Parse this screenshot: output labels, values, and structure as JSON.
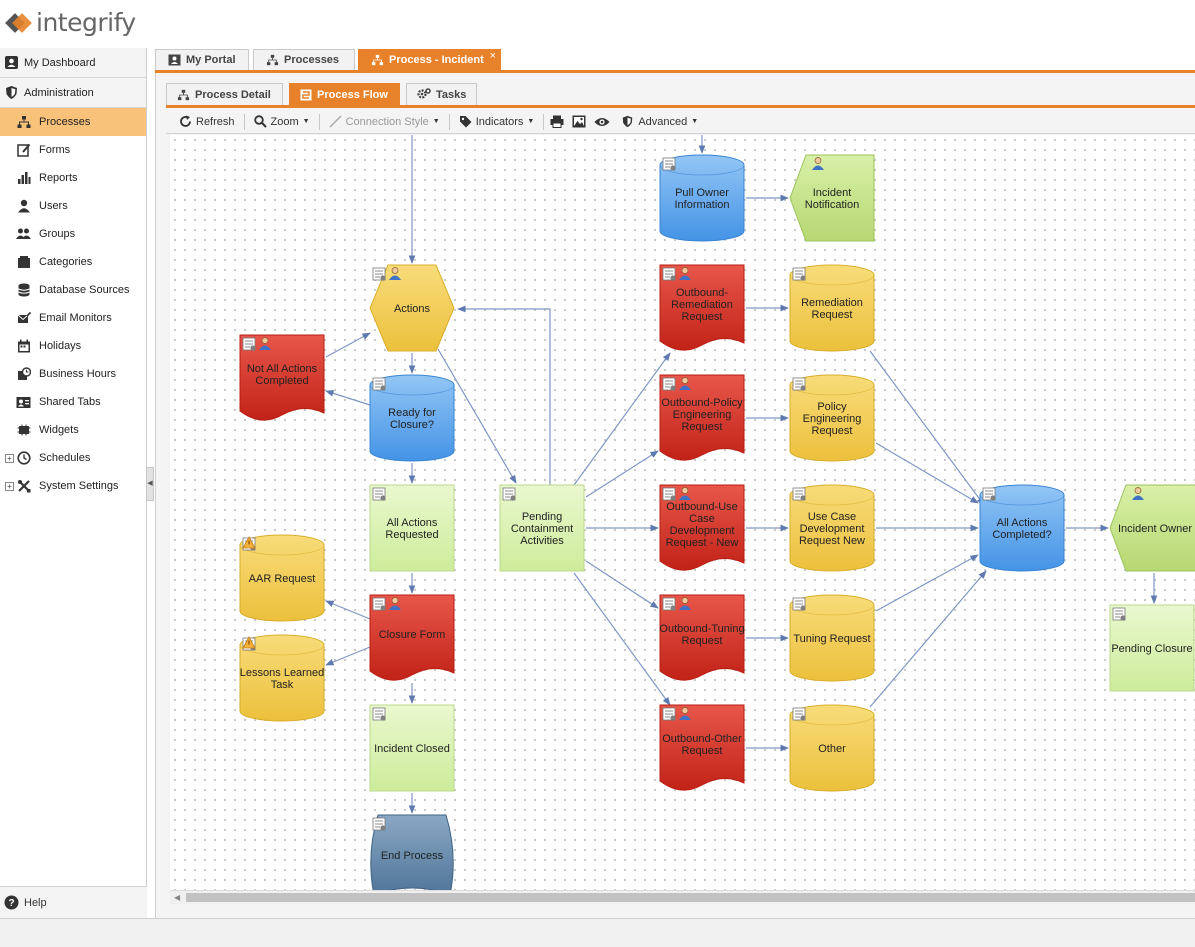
{
  "app": {
    "logo_text": "integrify"
  },
  "sidebar": {
    "dashboard_label": "My Dashboard",
    "admin_label": "Administration",
    "items": [
      {
        "label": "Processes",
        "icon": "sitemap-icon"
      },
      {
        "label": "Forms",
        "icon": "form-edit-icon"
      },
      {
        "label": "Reports",
        "icon": "bar-chart-icon"
      },
      {
        "label": "Users",
        "icon": "user-icon"
      },
      {
        "label": "Groups",
        "icon": "group-icon"
      },
      {
        "label": "Categories",
        "icon": "folder-icon"
      },
      {
        "label": "Database Sources",
        "icon": "database-icon"
      },
      {
        "label": "Email Monitors",
        "icon": "email-icon"
      },
      {
        "label": "Holidays",
        "icon": "calendar-icon"
      },
      {
        "label": "Business Hours",
        "icon": "clock-icon"
      },
      {
        "label": "Shared Tabs",
        "icon": "shared-tabs-icon"
      },
      {
        "label": "Widgets",
        "icon": "widget-icon"
      },
      {
        "label": "Schedules",
        "icon": "schedule-icon"
      },
      {
        "label": "System Settings",
        "icon": "tools-icon"
      }
    ],
    "help_label": "Help"
  },
  "tabs": {
    "my_portal": "My Portal",
    "processes": "Processes",
    "process_incident": "Process - Incident",
    "close_glyph": "×"
  },
  "subtabs": {
    "process_detail": "Process Detail",
    "process_flow": "Process Flow",
    "tasks": "Tasks"
  },
  "toolbar": {
    "refresh": "Refresh",
    "zoom": "Zoom",
    "connection_style": "Connection Style",
    "indicators": "Indicators",
    "advanced": "Advanced"
  },
  "colors": {
    "accent": "#e8822a",
    "active_sidebar": "#f9c27b",
    "red_task": "#d9362b",
    "yellow_task": "#f2c94c",
    "blue_task": "#5aa3ec",
    "green_task": "#d4f0a8",
    "dark_task": "#5f84a6"
  },
  "flow": {
    "nodes": [
      {
        "id": "pull_owner",
        "label": "Pull Owner Information",
        "shape": "cylinder",
        "color": "blue"
      },
      {
        "id": "incident_notification",
        "label": "Incident Notification",
        "shape": "pentagon",
        "color": "green"
      },
      {
        "id": "actions",
        "label": "Actions",
        "shape": "hexagon",
        "color": "yellow"
      },
      {
        "id": "not_all_actions",
        "label": "Not All Actions Completed",
        "shape": "document",
        "color": "red"
      },
      {
        "id": "ready_for_closure",
        "label": "Ready for Closure?",
        "shape": "cylinder",
        "color": "blue"
      },
      {
        "id": "all_actions_requested",
        "label": "All Actions Requested",
        "shape": "rect",
        "color": "green"
      },
      {
        "id": "pending_containment",
        "label": "Pending Containment Activities",
        "shape": "rect",
        "color": "green"
      },
      {
        "id": "aar_request",
        "label": "AAR Request",
        "shape": "cylinder",
        "color": "yellow"
      },
      {
        "id": "closure_form",
        "label": "Closure Form",
        "shape": "document",
        "color": "red"
      },
      {
        "id": "lessons_learned",
        "label": "Lessons Learned Task",
        "shape": "cylinder",
        "color": "yellow"
      },
      {
        "id": "incident_closed",
        "label": "Incident Closed",
        "shape": "rect",
        "color": "green"
      },
      {
        "id": "end_process",
        "label": "End Process",
        "shape": "end",
        "color": "dark"
      },
      {
        "id": "ob_remediation",
        "label": "Outbound-Remediation Request",
        "shape": "document",
        "color": "red"
      },
      {
        "id": "remediation_request",
        "label": "Remediation Request",
        "shape": "cylinder",
        "color": "yellow"
      },
      {
        "id": "ob_policy",
        "label": "Outbound-Policy Engineering Request",
        "shape": "document",
        "color": "red"
      },
      {
        "id": "policy_request",
        "label": "Policy Engineering Request",
        "shape": "cylinder",
        "color": "yellow"
      },
      {
        "id": "ob_usecase",
        "label": "Outbound-Use Case Development Request - New",
        "shape": "document",
        "color": "red"
      },
      {
        "id": "usecase_request",
        "label": "Use Case Development Request New",
        "shape": "cylinder",
        "color": "yellow"
      },
      {
        "id": "ob_tuning",
        "label": "Outbound-Tuning Request",
        "shape": "document",
        "color": "red"
      },
      {
        "id": "tuning_request",
        "label": "Tuning Request",
        "shape": "cylinder",
        "color": "yellow"
      },
      {
        "id": "ob_other",
        "label": "Outbound-Other Request",
        "shape": "document",
        "color": "red"
      },
      {
        "id": "other",
        "label": "Other",
        "shape": "cylinder",
        "color": "yellow"
      },
      {
        "id": "all_actions_completed",
        "label": "All Actions Completed?",
        "shape": "cylinder",
        "color": "blue"
      },
      {
        "id": "incident_owner",
        "label": "Incident Owner",
        "shape": "pentagon",
        "color": "green"
      },
      {
        "id": "pending_closure",
        "label": "Pending Closure",
        "shape": "rect",
        "color": "green"
      }
    ]
  }
}
